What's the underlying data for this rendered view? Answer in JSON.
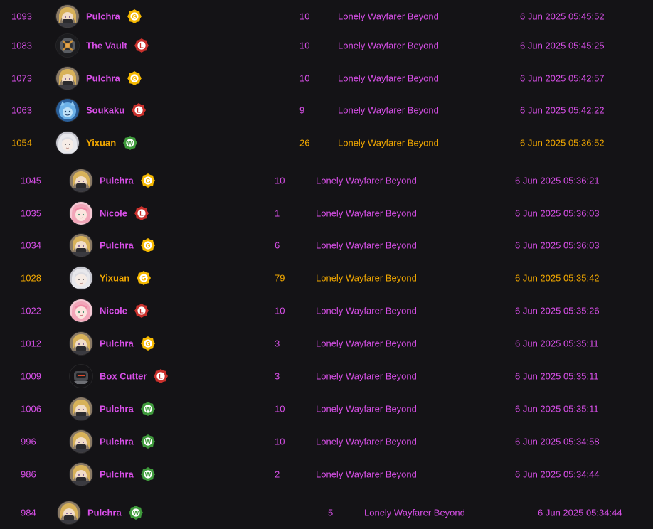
{
  "colors": {
    "purple": "#d84fe8",
    "orange": "#f2a800",
    "bg": "#141316"
  },
  "rows": [
    {
      "id": "1093",
      "name": "Pulchra",
      "avatar": "pulchra-avatar",
      "badge": "G",
      "badge_color": "#f5b800",
      "count": "10",
      "mode": "Lonely Wayfarer Beyond",
      "time": "6 Jun 2025 05:45:52",
      "color": "#d84fe8"
    },
    {
      "id": "1083",
      "name": "The Vault",
      "avatar": "vault-avatar",
      "badge": "L",
      "badge_color": "#c9302c",
      "count": "10",
      "mode": "Lonely Wayfarer Beyond",
      "time": "6 Jun 2025 05:45:25",
      "color": "#d84fe8"
    },
    {
      "id": "1073",
      "name": "Pulchra",
      "avatar": "pulchra-avatar",
      "badge": "G",
      "badge_color": "#f5b800",
      "count": "10",
      "mode": "Lonely Wayfarer Beyond",
      "time": "6 Jun 2025 05:42:57",
      "color": "#d84fe8"
    },
    {
      "id": "1063",
      "name": "Soukaku",
      "avatar": "soukaku-avatar",
      "badge": "L",
      "badge_color": "#c9302c",
      "count": "9",
      "mode": "Lonely Wayfarer Beyond",
      "time": "6 Jun 2025 05:42:22",
      "color": "#d84fe8"
    },
    {
      "id": "1054",
      "name": "Yixuan",
      "avatar": "yixuan-avatar",
      "badge": "W",
      "badge_color": "#3f9a3c",
      "count": "26",
      "mode": "Lonely Wayfarer Beyond",
      "time": "6 Jun 2025 05:36:52",
      "color": "#f2a800"
    },
    {
      "id": "1045",
      "name": "Pulchra",
      "avatar": "pulchra-avatar",
      "badge": "G",
      "badge_color": "#f5b800",
      "count": "10",
      "mode": "Lonely Wayfarer Beyond",
      "time": "6 Jun 2025 05:36:21",
      "color": "#d84fe8"
    },
    {
      "id": "1035",
      "name": "Nicole",
      "avatar": "nicole-avatar",
      "badge": "L",
      "badge_color": "#c9302c",
      "count": "1",
      "mode": "Lonely Wayfarer Beyond",
      "time": "6 Jun 2025 05:36:03",
      "color": "#d84fe8"
    },
    {
      "id": "1034",
      "name": "Pulchra",
      "avatar": "pulchra-avatar",
      "badge": "G",
      "badge_color": "#f5b800",
      "count": "6",
      "mode": "Lonely Wayfarer Beyond",
      "time": "6 Jun 2025 05:36:03",
      "color": "#d84fe8"
    },
    {
      "id": "1028",
      "name": "Yixuan",
      "avatar": "yixuan-avatar",
      "badge": "G",
      "badge_color": "#f5b800",
      "count": "79",
      "mode": "Lonely Wayfarer Beyond",
      "time": "6 Jun 2025 05:35:42",
      "color": "#f2a800"
    },
    {
      "id": "1022",
      "name": "Nicole",
      "avatar": "nicole-avatar",
      "badge": "L",
      "badge_color": "#c9302c",
      "count": "10",
      "mode": "Lonely Wayfarer Beyond",
      "time": "6 Jun 2025 05:35:26",
      "color": "#d84fe8"
    },
    {
      "id": "1012",
      "name": "Pulchra",
      "avatar": "pulchra-avatar",
      "badge": "G",
      "badge_color": "#f5b800",
      "count": "3",
      "mode": "Lonely Wayfarer Beyond",
      "time": "6 Jun 2025 05:35:11",
      "color": "#d84fe8"
    },
    {
      "id": "1009",
      "name": "Box Cutter",
      "avatar": "box-cutter-avatar",
      "badge": "L",
      "badge_color": "#c9302c",
      "count": "3",
      "mode": "Lonely Wayfarer Beyond",
      "time": "6 Jun 2025 05:35:11",
      "color": "#d84fe8"
    },
    {
      "id": "1006",
      "name": "Pulchra",
      "avatar": "pulchra-avatar",
      "badge": "W",
      "badge_color": "#3f9a3c",
      "count": "10",
      "mode": "Lonely Wayfarer Beyond",
      "time": "6 Jun 2025 05:35:11",
      "color": "#d84fe8"
    },
    {
      "id": "996",
      "name": "Pulchra",
      "avatar": "pulchra-avatar",
      "badge": "W",
      "badge_color": "#3f9a3c",
      "count": "10",
      "mode": "Lonely Wayfarer Beyond",
      "time": "6 Jun 2025 05:34:58",
      "color": "#d84fe8"
    },
    {
      "id": "986",
      "name": "Pulchra",
      "avatar": "pulchra-avatar",
      "badge": "W",
      "badge_color": "#3f9a3c",
      "count": "2",
      "mode": "Lonely Wayfarer Beyond",
      "time": "6 Jun 2025 05:34:44",
      "color": "#d84fe8"
    },
    {
      "id": "984",
      "name": "Pulchra",
      "avatar": "pulchra-avatar",
      "badge": "W",
      "badge_color": "#3f9a3c",
      "count": "5",
      "mode": "Lonely Wayfarer Beyond",
      "time": "6 Jun 2025 05:34:44",
      "color": "#d84fe8"
    }
  ]
}
